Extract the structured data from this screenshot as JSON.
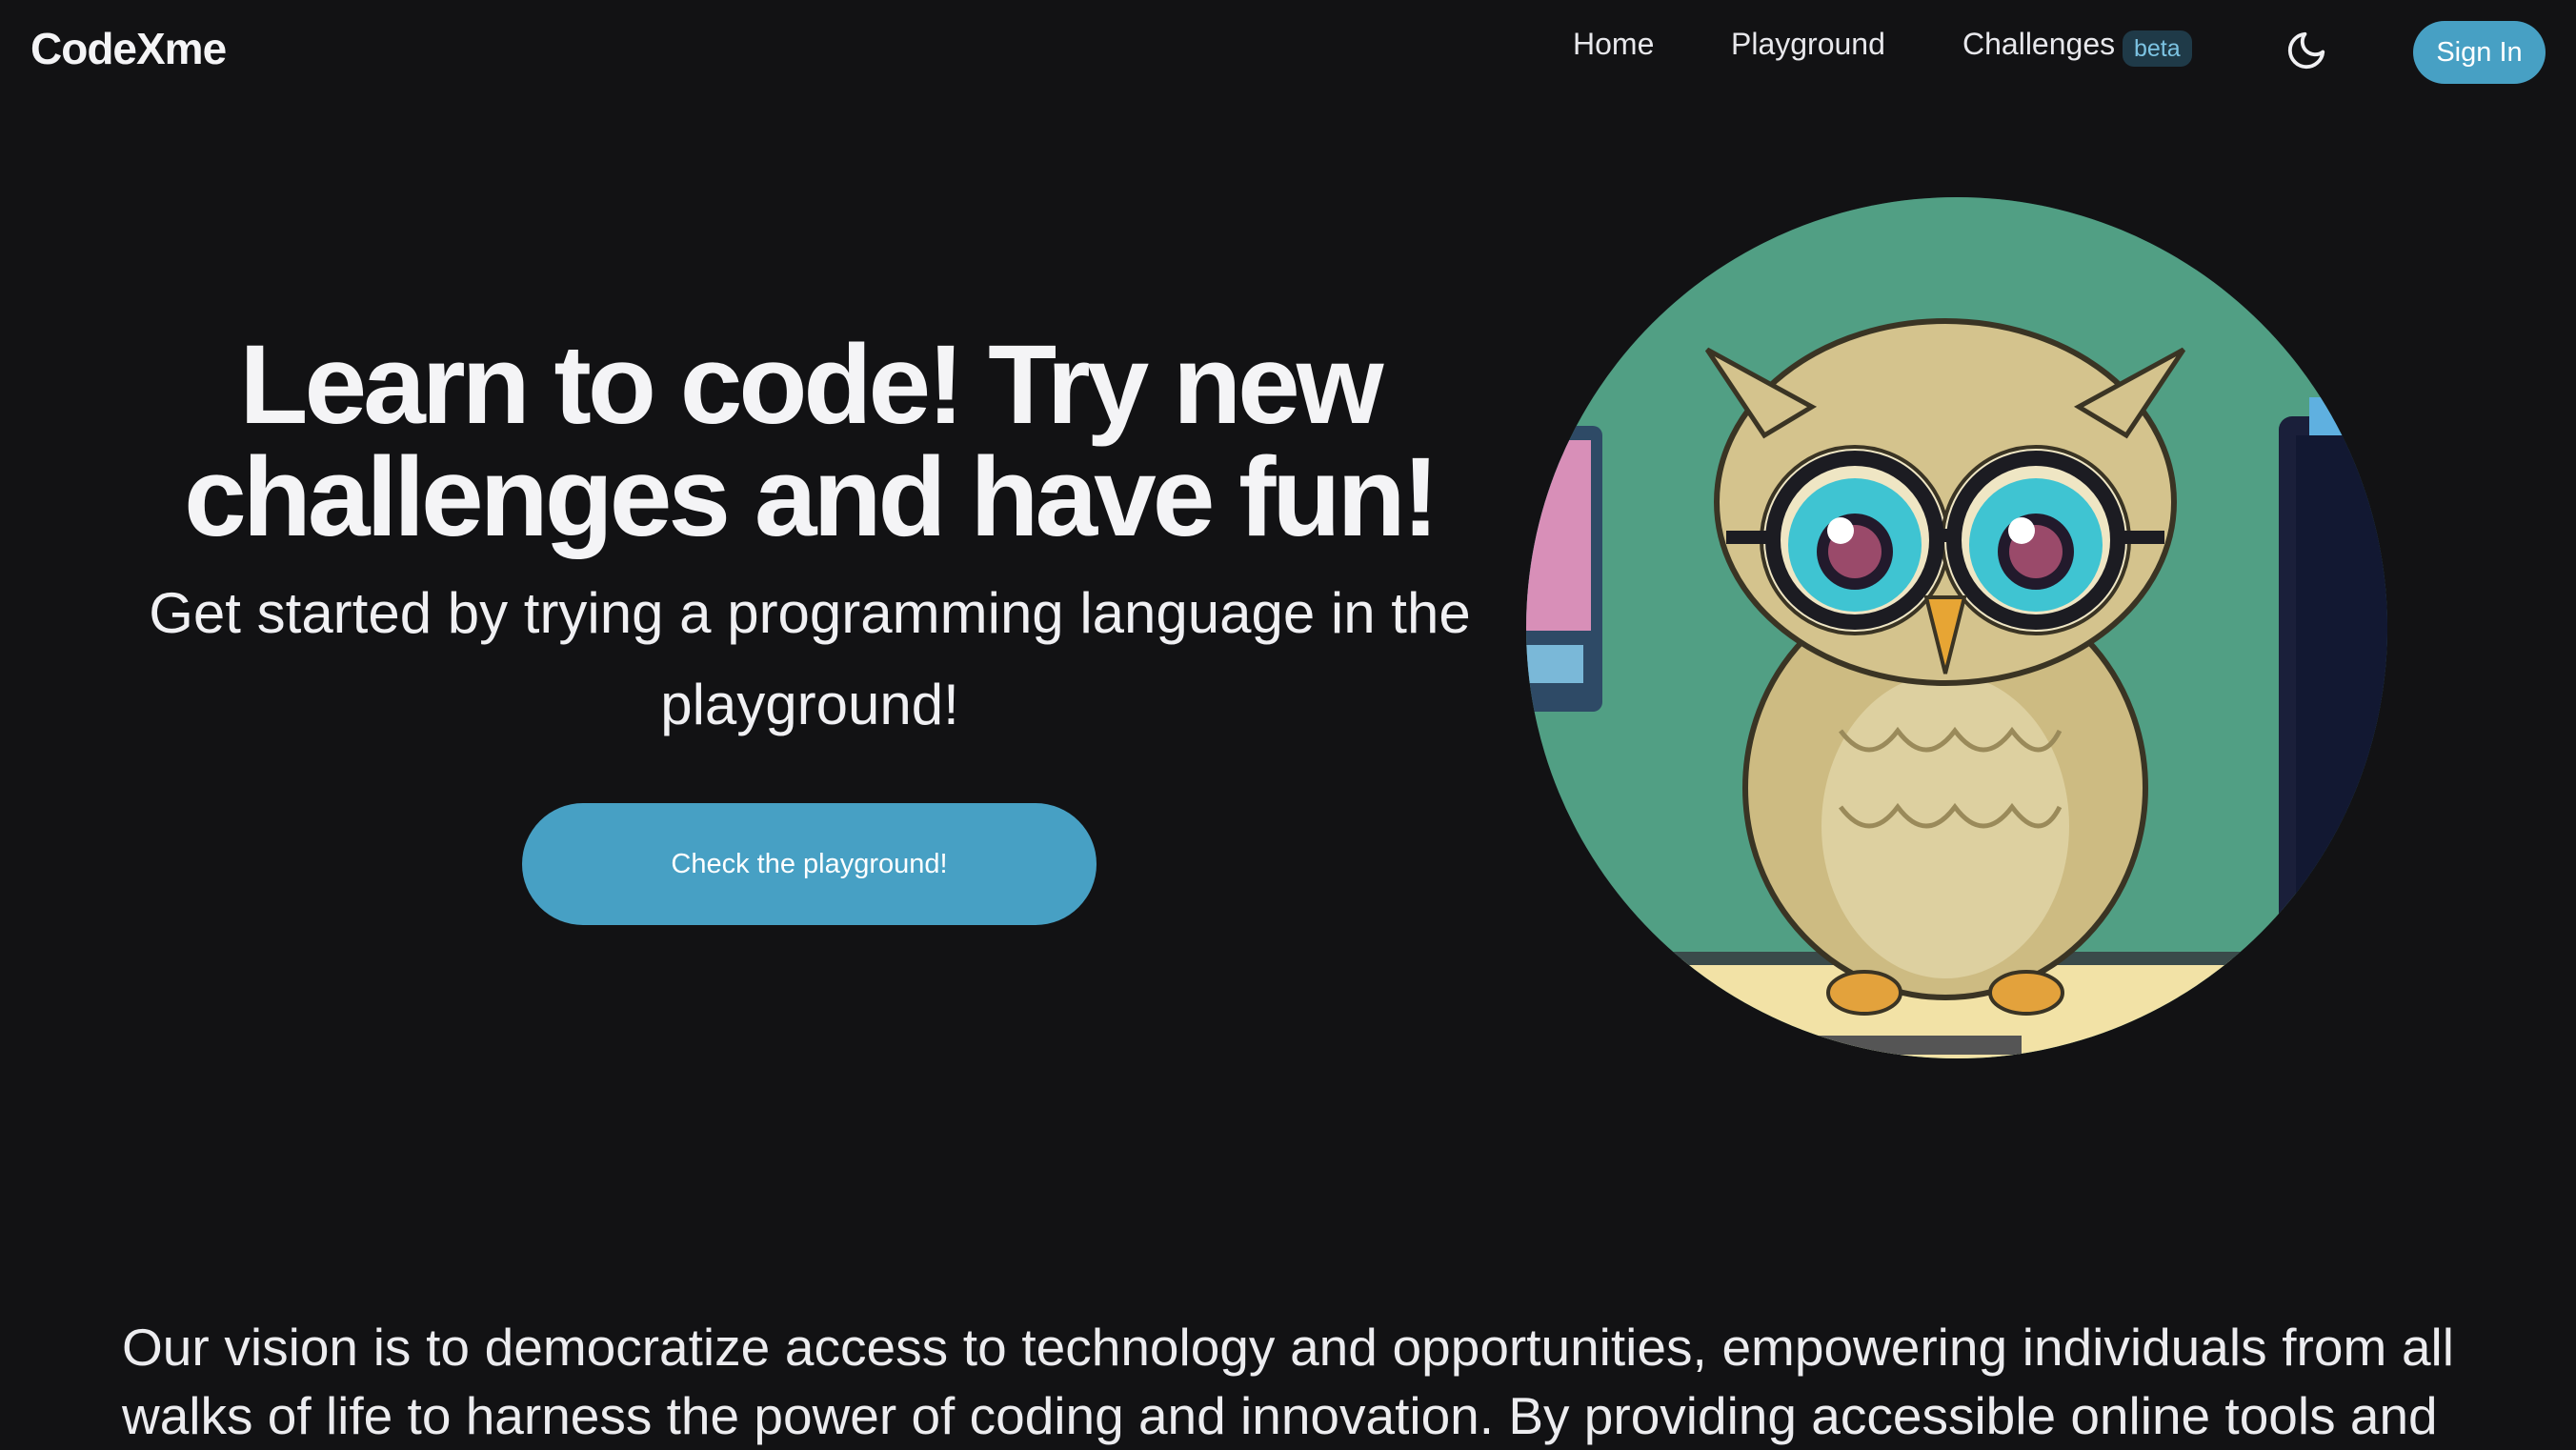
{
  "nav": {
    "brand": "CodeXme",
    "links": {
      "home": "Home",
      "playground": "Playground",
      "challenges": "Challenges"
    },
    "challenges_badge": "beta",
    "theme_toggle_icon": "moon-icon",
    "signin_label": "Sign In"
  },
  "hero": {
    "title": "Learn to code! Try new challenges and have fun!",
    "subtitle": "Get started by trying a programming language in the playground!",
    "cta_label": "Check the playground!"
  },
  "vision": {
    "text": "Our vision is to democratize access to technology and opportunities, empowering individuals from all walks of life to harness the power of coding and innovation. By providing accessible online tools and"
  },
  "colors": {
    "background": "#121214",
    "accent": "#47a0c4",
    "badge_bg": "#1f3a48",
    "badge_text": "#7cc3e2",
    "text": "#ececef"
  }
}
